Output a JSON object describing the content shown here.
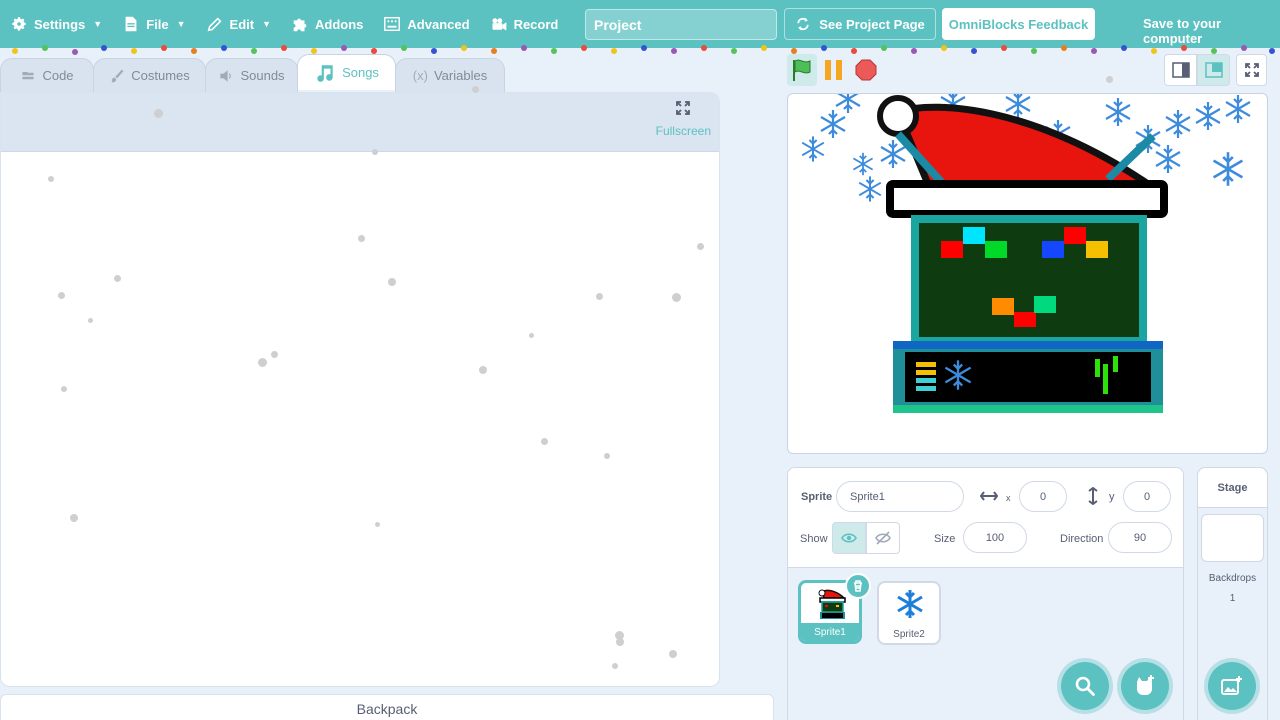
{
  "menu": {
    "settings": "Settings",
    "file": "File",
    "edit": "Edit",
    "addons": "Addons",
    "advanced": "Advanced",
    "record": "Record",
    "project_title": "Project",
    "see_project_page": "See Project Page",
    "feedback": "OmniBlocks Feedback",
    "save_to_computer": "Save to your computer"
  },
  "tabs": [
    {
      "label": "Code",
      "icon": "code-icon"
    },
    {
      "label": "Costumes",
      "icon": "brush-icon"
    },
    {
      "label": "Sounds",
      "icon": "speaker-icon"
    },
    {
      "label": "Songs",
      "icon": "music-note-icon",
      "active": true
    },
    {
      "label": "Variables",
      "icon": "variable-icon"
    }
  ],
  "editor": {
    "fullscreen_label": "Fullscreen"
  },
  "backpack_label": "Backpack",
  "sprite_info": {
    "sprite_label": "Sprite",
    "sprite_name": "Sprite1",
    "x_label": "x",
    "x_value": "0",
    "y_label": "y",
    "y_value": "0",
    "show_label": "Show",
    "size_label": "Size",
    "size_value": "100",
    "direction_label": "Direction",
    "direction_value": "90"
  },
  "sprites": [
    {
      "name": "Sprite1",
      "selected": true
    },
    {
      "name": "Sprite2",
      "selected": false
    }
  ],
  "stage_panel": {
    "title": "Stage",
    "backdrops_label": "Backdrops",
    "backdrops_count": "1"
  },
  "colors": {
    "accent": "#5cc1c1",
    "background": "#e8f0fa"
  }
}
